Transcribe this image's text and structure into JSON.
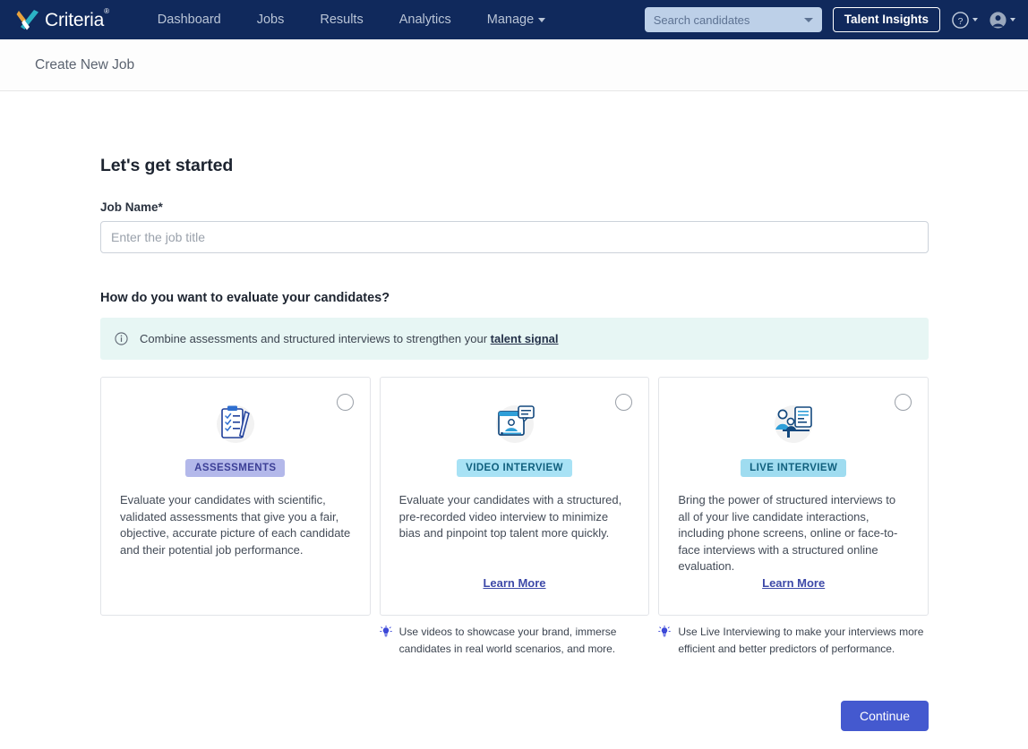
{
  "nav": {
    "brand": {
      "name": "Criteria",
      "trademark": "®",
      "icon": "criteria-x-logo-icon"
    },
    "links": [
      {
        "label": "Dashboard",
        "has_caret": false
      },
      {
        "label": "Jobs",
        "has_caret": false
      },
      {
        "label": "Results",
        "has_caret": false
      },
      {
        "label": "Analytics",
        "has_caret": false
      },
      {
        "label": "Manage",
        "has_caret": true
      }
    ],
    "search": {
      "placeholder": "Search candidates",
      "value": ""
    },
    "talent_insights_label": "Talent Insights",
    "help_icon": "question-circle-icon",
    "avatar_icon": "user-avatar-icon",
    "bg_color": "#10295c"
  },
  "subheader": {
    "title": "Create New Job"
  },
  "main": {
    "heading": "Let's get started",
    "job_name_label": "Job Name*",
    "job_name_placeholder": "Enter the job title",
    "job_name_value": "",
    "evaluate_heading": "How do you want to evaluate your candidates?",
    "info_banner": {
      "icon": "info-circle-icon",
      "text_before": "Combine assessments and structured interviews to strengthen your ",
      "link_text": "talent signal",
      "bg_color": "#e7f6f4"
    },
    "cards": [
      {
        "badge": "ASSESSMENTS",
        "badge_bg": "#b3b8ea",
        "badge_color": "#3c3f96",
        "icon": "clipboard-checklist-icon",
        "description": "Evaluate your candidates with scientific, validated assessments that give you a fair, objective, accurate picture of each candidate and their potential job performance.",
        "learn_more": "",
        "selected": false,
        "hint": ""
      },
      {
        "badge": "VIDEO INTERVIEW",
        "badge_bg": "#a8e2f5",
        "badge_color": "#11607e",
        "icon": "video-interview-icon",
        "description": "Evaluate your candidates with a structured, pre-recorded video interview to minimize bias and pinpoint top talent more quickly.",
        "learn_more": "Learn More",
        "selected": false,
        "hint": "Use videos to showcase your brand, immerse candidates in real world scenarios, and more."
      },
      {
        "badge": "LIVE INTERVIEW",
        "badge_bg": "#9fdcf0",
        "badge_color": "#11607e",
        "icon": "live-interview-icon",
        "description": "Bring the power of structured interviews to all of your live candidate interactions, including phone screens, online or face-to-face interviews with a structured online evaluation.",
        "learn_more": "Learn More",
        "selected": false,
        "hint": "Use Live Interviewing to make your interviews more efficient and better predictors of performance."
      }
    ],
    "hint_icon": "lightbulb-idea-icon",
    "continue_label": "Continue",
    "continue_color": "#4459cf"
  }
}
